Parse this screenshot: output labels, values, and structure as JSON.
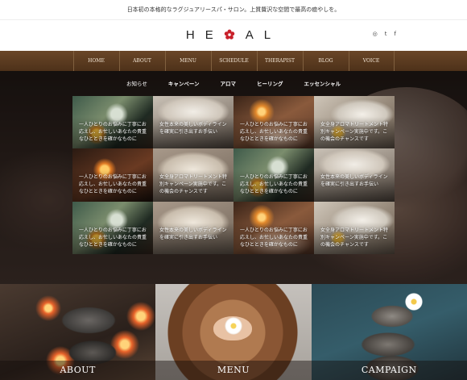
{
  "topbar": {
    "tagline": "日本初の本格的なラグジュアリースパ・サロン。上質贅沢な空間で最高の癒やしを。"
  },
  "header": {
    "logo_left": "HE",
    "logo_right": "AL",
    "social": [
      "instagram-icon",
      "twitter-icon",
      "facebook-icon"
    ],
    "social_glyphs": [
      "◎",
      "t",
      "f"
    ]
  },
  "nav": {
    "items": [
      "HOME",
      "ABOUT",
      "MENU",
      "SCHEDULE",
      "THERAPIST",
      "BLOG",
      "VOICE"
    ]
  },
  "subtabs": [
    "お知らせ",
    "キャンペーン",
    "アロマ",
    "ヒーリング",
    "エッセンシャル"
  ],
  "cards": [
    {
      "text": "一人ひとりのお悩みに丁寧にお応えし、お忙しいあなたの貴重なひとときを確かなものに"
    },
    {
      "text": "女性本来の美しいボディラインを確実に引き出すお手伝い"
    },
    {
      "text": "一人ひとりのお悩みに丁寧にお応えし、お忙しいあなたの貴重なひとときを確かなものに"
    },
    {
      "text": "女全身アロマトリートメント特別キャンペーン実施中です。この機会のチャンスです"
    },
    {
      "text": "一人ひとりのお悩みに丁寧にお応えし、お忙しいあなたの貴重なひとときを確かなものに"
    },
    {
      "text": "女全身アロマトリートメント特別キャンペーン実施中です。この機会のチャンスです"
    },
    {
      "text": "一人ひとりのお悩みに丁寧にお応えし、お忙しいあなたの貴重なひとときを確かなものに"
    },
    {
      "text": "女性本来の美しいボディラインを確実に引き出すお手伝い"
    },
    {
      "text": "一人ひとりのお悩みに丁寧にお応えし、お忙しいあなたの貴重なひとときを確かなものに"
    },
    {
      "text": "女性本来の美しいボディラインを確実に引き出すお手伝い"
    },
    {
      "text": "一人ひとりのお悩みに丁寧にお応えし、お忙しいあなたの貴重なひとときを確かなものに"
    },
    {
      "text": "女全身アロマトリートメント特別キャンペーン実施中です。この機会のチャンスです"
    }
  ],
  "panels": [
    "ABOUT",
    "MENU",
    "CAMPAIGN"
  ],
  "colors": {
    "nav": "#5b3a1f",
    "logo_flower": "#c8202a"
  }
}
